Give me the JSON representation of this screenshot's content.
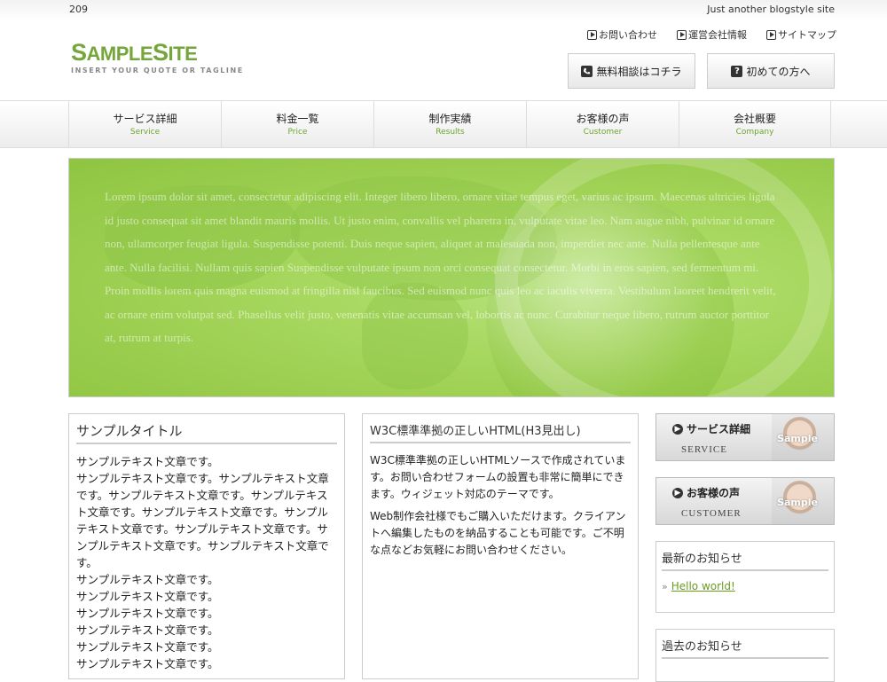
{
  "topbar": {
    "number": "209",
    "tagline": "Just another blogstyle site"
  },
  "logo": {
    "name_big_s": "S",
    "name_ample": "AMPLE",
    "name_big_s2": "S",
    "name_ite": "ITE",
    "tagline": "INSERT YOUR QUOTE OR TAGLINE"
  },
  "utility_links": [
    {
      "label": "お問い合わせ",
      "icon": "square-play-icon"
    },
    {
      "label": "運営会社情報",
      "icon": "square-play-icon"
    },
    {
      "label": "サイトマップ",
      "icon": "square-play-icon"
    }
  ],
  "cta": {
    "consult": {
      "label": "無料相談はコチラ",
      "icon": "phone-icon"
    },
    "first_time": {
      "label": "初めての方へ",
      "icon": "question-icon",
      "icon_glyph": "?"
    }
  },
  "nav": [
    {
      "jp": "サービス詳細",
      "en": "Service"
    },
    {
      "jp": "料金一覧",
      "en": "Price"
    },
    {
      "jp": "制作実績",
      "en": "Results"
    },
    {
      "jp": "お客様の声",
      "en": "Customer"
    },
    {
      "jp": "会社概要",
      "en": "Company"
    }
  ],
  "hero": {
    "lorem": "Lorem ipsum dolor sit amet, consectetur adipiscing elit. Integer libero libero, ornare vitae tempus eget, varius ac ipsum. Maecenas ultricies ligula id justo consequat sit amet blandit mauris mollis. Ut justo enim, convallis vel pharetra in, vulputate vitae leo. Nam augue nibh, pulvinar id ornare non, ullamcorper feugiat ligula. Suspendisse potenti. Duis neque sapien, aliquet at malesuada non, imperdiet nec ante. Nulla pellentesque ante ante. Nulla facilisi. Nullam quis sapien Suspendisse vulputate ipsum non orci consequat consectetur. Morbi in eros sapien, sed fermentum mi. Proin mollis lorem quis magna euismod at fringilla nisl faucibus. Sed euismod nunc quis leo ac iaculis viverra. Vestibulum laoreet hendrerit velit, ac ornare enim volutpat sed. Phasellus velit justo, venenatis vitae accumsan vel, lobortis ac nunc. Curabitur neque libero, rutrum auctor porttitor at, rutrum at turpis."
  },
  "panel_left": {
    "title": "サンプルタイトル",
    "lines": [
      "サンプルテキスト文章です。",
      "サンプルテキスト文章です。サンプルテキスト文章です。サンプルテキスト文章です。サンプルテキスト文章です。サンプルテキスト文章です。サンプルテキスト文章です。サンプルテキスト文章です。サンプルテキスト文章です。サンプルテキスト文章です。",
      "サンプルテキスト文章です。",
      "サンプルテキスト文章です。",
      "サンプルテキスト文章です。",
      "サンプルテキスト文章です。",
      "サンプルテキスト文章です。",
      "サンプルテキスト文章です。"
    ]
  },
  "panel_center": {
    "title": "W3C標準準拠の正しいHTML(H3見出し)",
    "p1": "W3C標準準拠の正しいHTMLソースで作成されています。お問い合わせフォームの設置も非常に簡単にできます。ウィジェット対応のテーマです。",
    "p2": "Web制作会社様でもご購入いただけます。クライアントへ編集したものを納品することも可能です。ご不明な点などお気軽にお問い合わせください。"
  },
  "side_banners": [
    {
      "label": "サービス詳細",
      "en": "Service",
      "overlay": "Sample",
      "icon": "arrow-circle-icon"
    },
    {
      "label": "お客様の声",
      "en": "Customer",
      "overlay": "Sample",
      "icon": "arrow-circle-icon"
    }
  ],
  "widgets": {
    "latest": {
      "title": "最新のお知らせ",
      "item": "Hello world!"
    },
    "past": {
      "title": "過去のお知らせ"
    }
  },
  "colors": {
    "accent_green": "#74a63a",
    "nav_en_green": "#6aa72c",
    "link_green": "#6a9c1f",
    "hero_green": "#a8d860"
  }
}
